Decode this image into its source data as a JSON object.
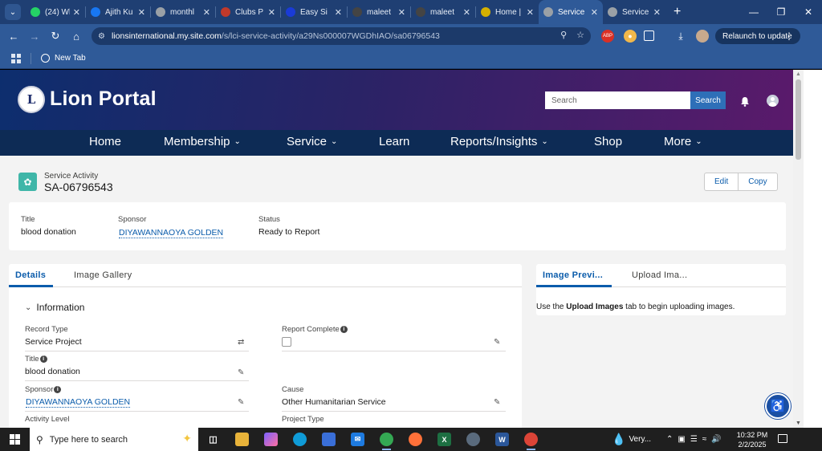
{
  "browser": {
    "tabs": [
      {
        "title": "(24) Wh",
        "favicon_color": "#25d366",
        "icon": "whatsapp-icon"
      },
      {
        "title": "Ajith Ku",
        "favicon_color": "#1877f2",
        "icon": "facebook-icon"
      },
      {
        "title": "monthl",
        "favicon_color": "#9aa0a6",
        "icon": "globe-icon"
      },
      {
        "title": "Clubs P",
        "favicon_color": "#c0392b",
        "icon": "clubs-icon"
      },
      {
        "title": "Easy Si",
        "favicon_color": "#1a3bd6",
        "icon": "easy-icon"
      },
      {
        "title": "maleet",
        "favicon_color": "#444444",
        "icon": "ai-icon"
      },
      {
        "title": "maleet",
        "favicon_color": "#444444",
        "icon": "ai-icon"
      },
      {
        "title": "Home |",
        "favicon_color": "#d4b000",
        "icon": "lions-icon"
      },
      {
        "title": "Service",
        "favicon_color": "#9aa0a6",
        "icon": "globe-icon",
        "active": true
      },
      {
        "title": "Service",
        "favicon_color": "#9aa0a6",
        "icon": "globe-icon"
      }
    ],
    "url_host": "lionsinternational.my.site.com",
    "url_path": "/s/lci-service-activity/a29Ns000007WGDhIAO/sa06796543",
    "relaunch_label": "Relaunch to update",
    "bookmarks": [
      {
        "label": "New Tab"
      }
    ]
  },
  "portal": {
    "brand": "Lion Portal",
    "logo_text": "L",
    "search_placeholder": "Search",
    "search_button": "Search",
    "nav": [
      {
        "label": "Home",
        "dropdown": false
      },
      {
        "label": "Membership",
        "dropdown": true
      },
      {
        "label": "Service",
        "dropdown": true
      },
      {
        "label": "Learn",
        "dropdown": false
      },
      {
        "label": "Reports/Insights",
        "dropdown": true
      },
      {
        "label": "Shop",
        "dropdown": false
      },
      {
        "label": "More",
        "dropdown": true
      }
    ]
  },
  "record": {
    "type_label": "Service Activity",
    "number": "SA-06796543",
    "actions": [
      "Edit",
      "Copy"
    ],
    "highlights": {
      "title_label": "Title",
      "title_value": "blood donation",
      "sponsor_label": "Sponsor",
      "sponsor_value": "DIYAWANNAOYA GOLDEN",
      "status_label": "Status",
      "status_value": "Ready to Report"
    }
  },
  "details": {
    "tabs": [
      "Details",
      "Image Gallery"
    ],
    "section": "Information",
    "fields": {
      "record_type_label": "Record Type",
      "record_type_value": "Service Project",
      "report_complete_label": "Report Complete",
      "title_label": "Title",
      "title_value": "blood donation",
      "sponsor_label": "Sponsor",
      "sponsor_value": "DIYAWANNAOYA GOLDEN",
      "cause_label": "Cause",
      "cause_value": "Other Humanitarian Service",
      "activity_level_label": "Activity Level",
      "project_type_label": "Project Type"
    }
  },
  "image_panel": {
    "tabs": [
      "Image Previ...",
      "Upload Ima..."
    ],
    "msg_prefix": "Use the",
    "msg_bold": "Upload Images",
    "msg_suffix": "tab to begin uploading images."
  },
  "taskbar": {
    "search_placeholder": "Type here to search",
    "weather": "Very...",
    "time": "10:32 PM",
    "date": "2/2/2025"
  }
}
